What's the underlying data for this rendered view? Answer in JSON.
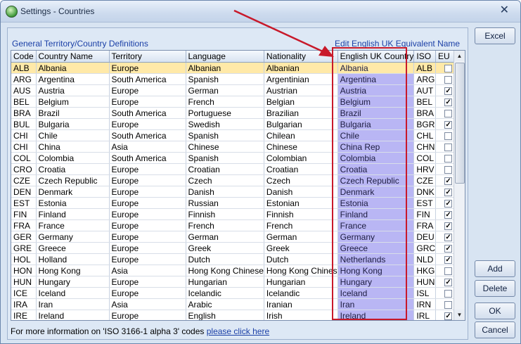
{
  "window": {
    "title": "Settings - Countries",
    "close_glyph": "✕"
  },
  "panel": {
    "left_label": "General Territory/Country Definitions",
    "right_label": "Edit English UK Equivalent Name"
  },
  "columns": {
    "code": "Code",
    "country": "Country Name",
    "territory": "Territory",
    "language": "Language",
    "nationality": "Nationality",
    "english": "English UK Country",
    "iso": "ISO",
    "eu": "EU"
  },
  "rows": [
    {
      "code": "ALB",
      "country": "Albania",
      "territory": "Europe",
      "language": "Albanian",
      "nationality": "Albanian",
      "english": "Albania",
      "iso": "ALB",
      "eu": false,
      "selected": true
    },
    {
      "code": "ARG",
      "country": "Argentina",
      "territory": "South America",
      "language": "Spanish",
      "nationality": "Argentinian",
      "english": "Argentina",
      "iso": "ARG",
      "eu": false
    },
    {
      "code": "AUS",
      "country": "Austria",
      "territory": "Europe",
      "language": "German",
      "nationality": "Austrian",
      "english": "Austria",
      "iso": "AUT",
      "eu": true
    },
    {
      "code": "BEL",
      "country": "Belgium",
      "territory": "Europe",
      "language": "French",
      "nationality": "Belgian",
      "english": "Belgium",
      "iso": "BEL",
      "eu": true
    },
    {
      "code": "BRA",
      "country": "Brazil",
      "territory": "South America",
      "language": "Portuguese",
      "nationality": "Brazilian",
      "english": "Brazil",
      "iso": "BRA",
      "eu": false
    },
    {
      "code": "BUL",
      "country": "Bulgaria",
      "territory": "Europe",
      "language": "Swedish",
      "nationality": "Bulgarian",
      "english": "Bulgaria",
      "iso": "BGR",
      "eu": true
    },
    {
      "code": "CHI",
      "country": "Chile",
      "territory": "South America",
      "language": "Spanish",
      "nationality": "Chilean",
      "english": "Chile",
      "iso": "CHL",
      "eu": false
    },
    {
      "code": "CHI",
      "country": "China",
      "territory": "Asia",
      "language": "Chinese",
      "nationality": "Chinese",
      "english": "China Rep",
      "iso": "CHN",
      "eu": false
    },
    {
      "code": "COL",
      "country": "Colombia",
      "territory": "South America",
      "language": "Spanish",
      "nationality": "Colombian",
      "english": "Colombia",
      "iso": "COL",
      "eu": false
    },
    {
      "code": "CRO",
      "country": "Croatia",
      "territory": "Europe",
      "language": "Croatian",
      "nationality": "Croatian",
      "english": "Croatia",
      "iso": "HRV",
      "eu": false
    },
    {
      "code": "CZE",
      "country": "Czech Republic",
      "territory": "Europe",
      "language": "Czech",
      "nationality": "Czech",
      "english": "Czech Republic",
      "iso": "CZE",
      "eu": true
    },
    {
      "code": "DEN",
      "country": "Denmark",
      "territory": "Europe",
      "language": "Danish",
      "nationality": "Danish",
      "english": "Denmark",
      "iso": "DNK",
      "eu": true
    },
    {
      "code": "EST",
      "country": "Estonia",
      "territory": "Europe",
      "language": "Russian",
      "nationality": "Estonian",
      "english": "Estonia",
      "iso": "EST",
      "eu": true
    },
    {
      "code": "FIN",
      "country": "Finland",
      "territory": "Europe",
      "language": "Finnish",
      "nationality": "Finnish",
      "english": "Finland",
      "iso": "FIN",
      "eu": true
    },
    {
      "code": "FRA",
      "country": "France",
      "territory": "Europe",
      "language": "French",
      "nationality": "French",
      "english": "France",
      "iso": "FRA",
      "eu": true
    },
    {
      "code": "GER",
      "country": "Germany",
      "territory": "Europe",
      "language": "German",
      "nationality": "German",
      "english": "Germany",
      "iso": "DEU",
      "eu": true
    },
    {
      "code": "GRE",
      "country": "Greece",
      "territory": "Europe",
      "language": "Greek",
      "nationality": "Greek",
      "english": "Greece",
      "iso": "GRC",
      "eu": true
    },
    {
      "code": "HOL",
      "country": "Holland",
      "territory": "Europe",
      "language": "Dutch",
      "nationality": "Dutch",
      "english": "Netherlands",
      "iso": "NLD",
      "eu": true
    },
    {
      "code": "HON",
      "country": "Hong Kong",
      "territory": "Asia",
      "language": "Hong Kong Chinese",
      "nationality": "Hong Kong Chines",
      "english": "Hong Kong",
      "iso": "HKG",
      "eu": false
    },
    {
      "code": "HUN",
      "country": "Hungary",
      "territory": "Europe",
      "language": "Hungarian",
      "nationality": "Hungarian",
      "english": "Hungary",
      "iso": "HUN",
      "eu": true
    },
    {
      "code": "ICE",
      "country": "Iceland",
      "territory": "Europe",
      "language": "Icelandic",
      "nationality": "Icelandic",
      "english": "Iceland",
      "iso": "ISL",
      "eu": false
    },
    {
      "code": "IRA",
      "country": "Iran",
      "territory": "Asia",
      "language": "Arabic",
      "nationality": "Iranian",
      "english": "Iran",
      "iso": "IRN",
      "eu": false
    },
    {
      "code": "IRE",
      "country": "Ireland",
      "territory": "Europe",
      "language": "English",
      "nationality": "Irish",
      "english": "Ireland",
      "iso": "IRL",
      "eu": true
    }
  ],
  "scrollbar": {
    "up_glyph": "▲",
    "down_glyph": "▼"
  },
  "footer": {
    "text": "For more information on 'ISO 3166-1 alpha 3' codes ",
    "link": "please click here"
  },
  "buttons": {
    "excel": "Excel",
    "add": "Add",
    "delete": "Delete",
    "ok": "OK",
    "cancel": "Cancel"
  },
  "annotation": {
    "highlight_color": "#c8192a",
    "column_color": "#b9b6f4",
    "selected_row_color": "#ffe9a8"
  }
}
